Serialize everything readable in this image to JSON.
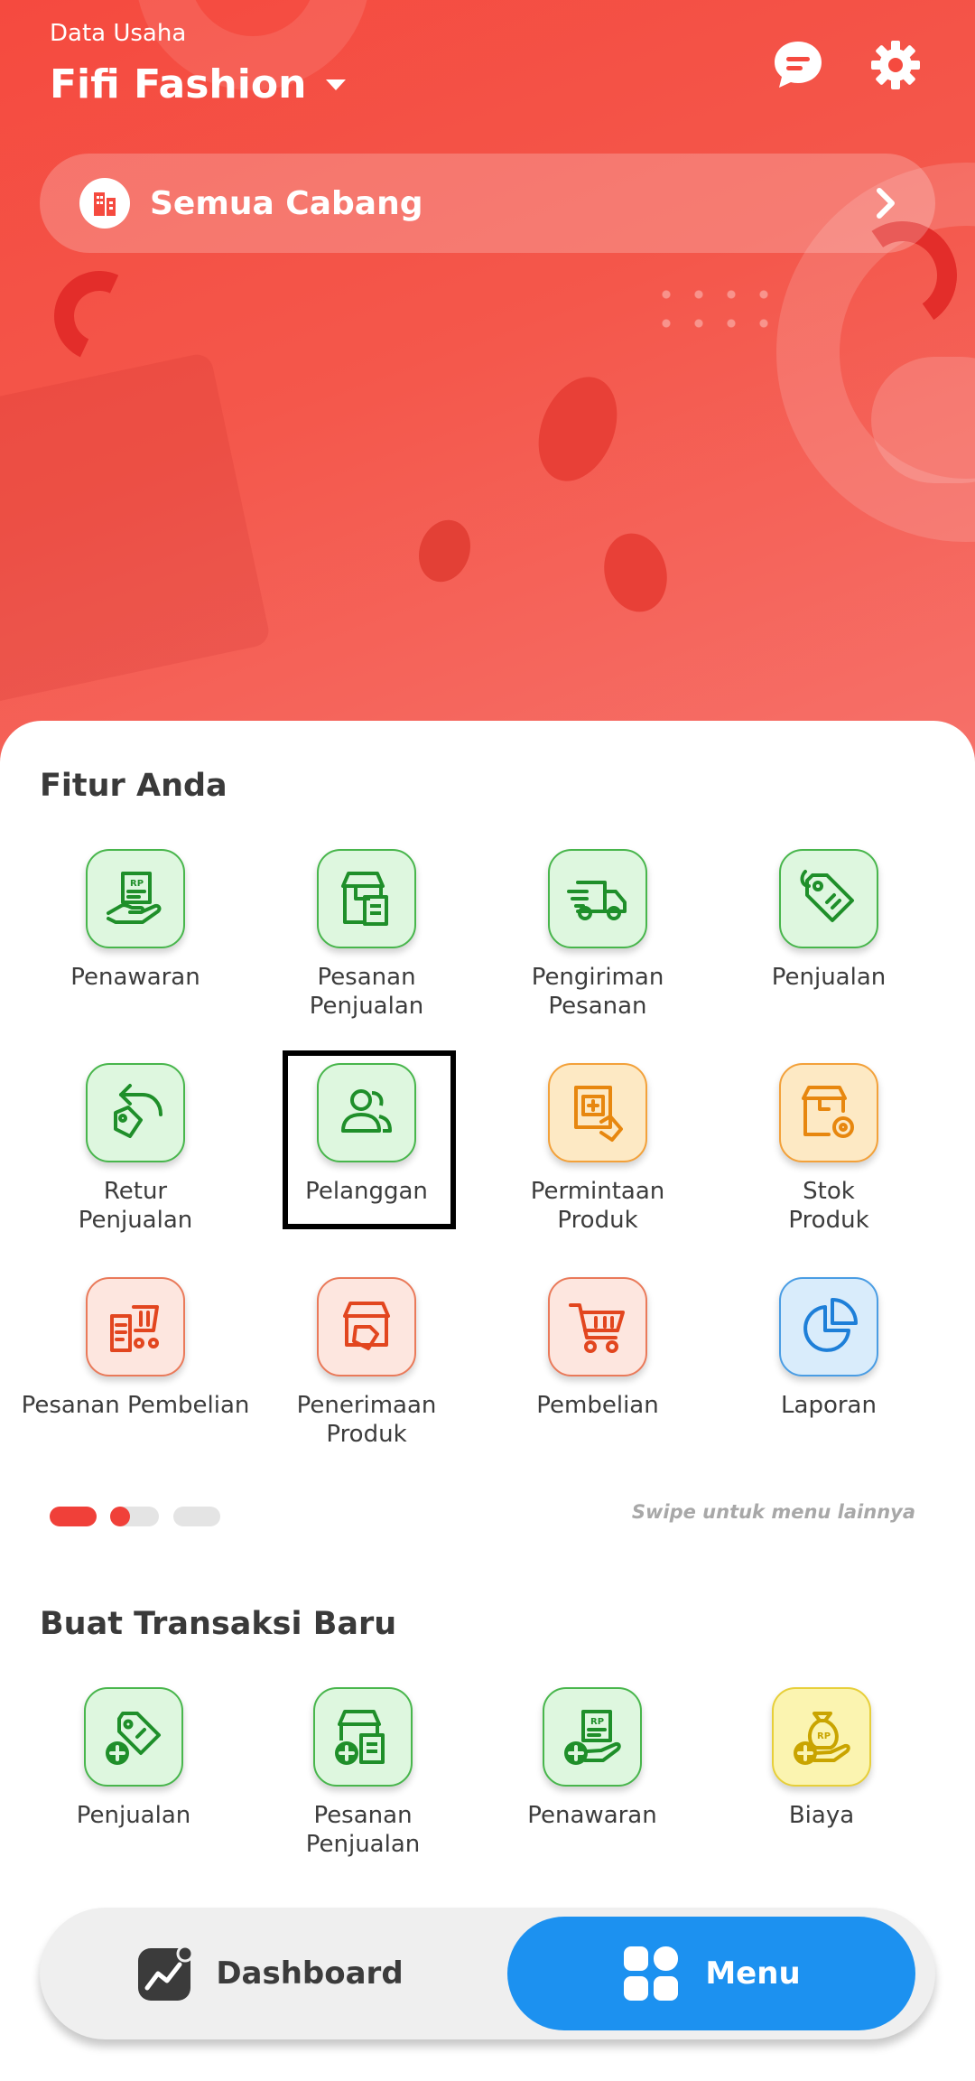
{
  "header": {
    "business_label": "Data Usaha",
    "business_name": "Fifi Fashion",
    "branch_label": "Semua Cabang"
  },
  "features": {
    "title": "Fitur Anda",
    "items": [
      {
        "label": "Penawaran",
        "icon": "receipt-hand-icon",
        "color": "green"
      },
      {
        "label": "Pesanan\nPenjualan",
        "icon": "sales-order-icon",
        "color": "green"
      },
      {
        "label": "Pengiriman\nPesanan",
        "icon": "delivery-truck-icon",
        "color": "green"
      },
      {
        "label": "Penjualan",
        "icon": "price-tag-icon",
        "color": "green"
      },
      {
        "label": "Retur\nPenjualan",
        "icon": "return-tag-icon",
        "color": "green"
      },
      {
        "label": "Pelanggan",
        "icon": "customers-icon",
        "color": "green"
      },
      {
        "label": "Permintaan\nProduk",
        "icon": "product-request-icon",
        "color": "orange"
      },
      {
        "label": "Stok\nProduk",
        "icon": "stock-box-icon",
        "color": "orange"
      },
      {
        "label": "Pesanan Pembelian",
        "icon": "purchase-order-cart-icon",
        "color": "salmon"
      },
      {
        "label": "Penerimaan\nProduk",
        "icon": "product-receipt-icon",
        "color": "salmon"
      },
      {
        "label": "Pembelian",
        "icon": "shopping-cart-icon",
        "color": "salmon"
      },
      {
        "label": "Laporan",
        "icon": "pie-chart-icon",
        "color": "blue"
      }
    ],
    "swipe_hint": "Swipe untuk menu lainnya",
    "page_count": 3,
    "active_page": 1
  },
  "transactions": {
    "title": "Buat Transaksi Baru",
    "items": [
      {
        "label": "Penjualan",
        "icon": "add-sale-tag-icon",
        "color": "green"
      },
      {
        "label": "Pesanan\nPenjualan",
        "icon": "add-sales-order-icon",
        "color": "green"
      },
      {
        "label": "Penawaran",
        "icon": "add-quotation-icon",
        "color": "green"
      },
      {
        "label": "Biaya",
        "icon": "add-expense-bag-icon",
        "color": "yellow"
      }
    ]
  },
  "nav": {
    "dashboard_label": "Dashboard",
    "menu_label": "Menu"
  },
  "colors": {
    "brand_red": "#f54a3f",
    "accent_blue": "#1c91f0",
    "green": "#1f8f2a",
    "orange": "#e7870f",
    "salmon": "#e2461f"
  }
}
